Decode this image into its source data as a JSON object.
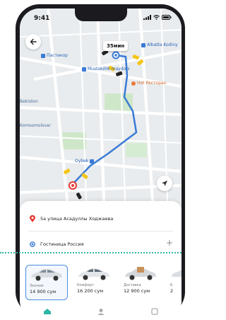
{
  "status_bar": {
    "time": "9:41"
  },
  "map": {
    "eta": "35мин",
    "places": {
      "albatros": "Albatta Kodiny",
      "pastor": "Пастикор",
      "mustakillik": "Mustakillik maydoni",
      "restaurant": "Hot Ресторан",
      "bekiston": "Bekiston",
      "komsomol": "Komsomolsvar",
      "oybek": "Oybek"
    }
  },
  "sheet": {
    "from_address": "5а улица Асадуллы Ходжаева",
    "to_address": "Гостиница Россия",
    "add_symbol": "+"
  },
  "tariffs": [
    {
      "name": "Эконом",
      "price": "14 900 сум"
    },
    {
      "name": "Комфорт",
      "price": "16 200 сум"
    },
    {
      "name": "Доставка",
      "price": "12 900 сум"
    },
    {
      "name": "Б",
      "price": "2"
    }
  ],
  "colors": {
    "route": "#3a7bd5",
    "pin": "#e53935",
    "accent": "#4a8de0",
    "divider_line": "#2fb6a4"
  },
  "icons": [
    "arrow-left-icon",
    "navigation-arrow-icon",
    "location-pin-icon",
    "origin-dot-icon",
    "plus-icon",
    "taxi-car-icon",
    "home-nav-icon",
    "profile-nav-icon",
    "history-nav-icon"
  ]
}
